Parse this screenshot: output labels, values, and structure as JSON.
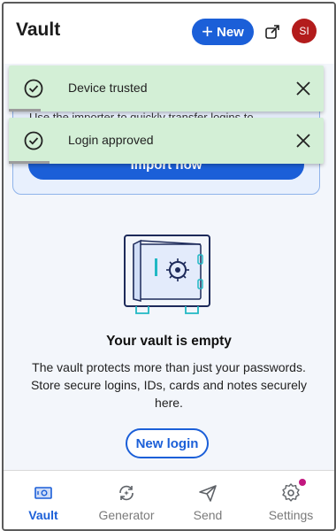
{
  "header": {
    "title": "Vault",
    "new_button_label": "New",
    "avatar_initials": "SI"
  },
  "import_card": {
    "text": "Use the importer to quickly transfer logins to",
    "button_label": "Import now"
  },
  "toasts": [
    {
      "message": "Device trusted",
      "progress": 0.1
    },
    {
      "message": "Login approved",
      "progress": 0.13
    }
  ],
  "empty_state": {
    "title": "Your vault is empty",
    "description": "The vault protects more than just your passwords. Store secure logins, IDs, cards and notes securely here.",
    "button_label": "New login"
  },
  "bottom_nav": {
    "items": [
      {
        "label": "Vault",
        "icon": "vault-icon",
        "active": true
      },
      {
        "label": "Generator",
        "icon": "generator-icon",
        "active": false
      },
      {
        "label": "Send",
        "icon": "send-icon",
        "active": false
      },
      {
        "label": "Settings",
        "icon": "gear-icon",
        "active": false,
        "badge": true
      }
    ]
  },
  "colors": {
    "primary": "#1b5fd8",
    "toast_bg": "#d3efd6",
    "avatar_bg": "#b31c1c",
    "badge": "#c2177f"
  }
}
